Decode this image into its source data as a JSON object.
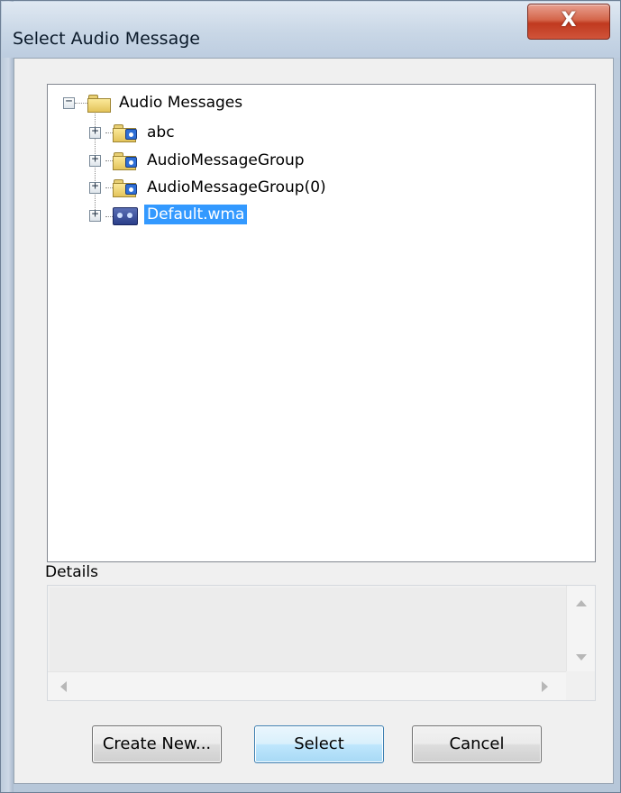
{
  "window": {
    "title": "Select Audio Message",
    "close_label": "X"
  },
  "tree": {
    "root": {
      "label": "Audio Messages",
      "expander": "−",
      "icon": "folder-icon"
    },
    "items": [
      {
        "label": "abc",
        "expander": "+",
        "icon": "audio-folder-icon",
        "selected": false
      },
      {
        "label": "AudioMessageGroup",
        "expander": "+",
        "icon": "audio-folder-icon",
        "selected": false
      },
      {
        "label": "AudioMessageGroup(0)",
        "expander": "+",
        "icon": "audio-folder-icon",
        "selected": false
      },
      {
        "label": "Default.wma",
        "expander": "+",
        "icon": "audio-file-icon",
        "selected": true
      }
    ]
  },
  "details": {
    "label": "Details",
    "text": ""
  },
  "buttons": {
    "create_new": "Create New...",
    "select": "Select",
    "cancel": "Cancel"
  },
  "colors": {
    "selection": "#3399ff",
    "close_button": "#c0391f",
    "default_button_border": "#3c7fb1"
  }
}
